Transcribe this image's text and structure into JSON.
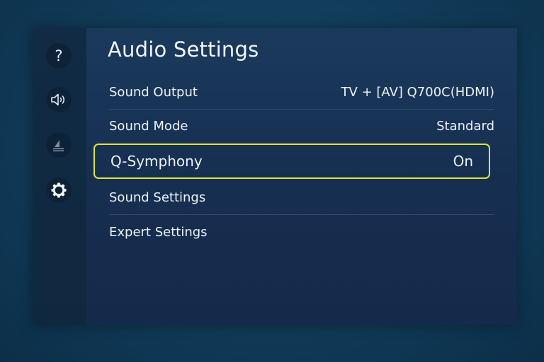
{
  "sidebar": {
    "items": [
      {
        "id": "support",
        "icon": "help-icon",
        "glyph": "?"
      },
      {
        "id": "sound",
        "icon": "speaker-icon"
      },
      {
        "id": "broadcasting",
        "icon": "broadcast-icon"
      },
      {
        "id": "general",
        "icon": "gear-icon"
      }
    ]
  },
  "page": {
    "title": "Audio Settings"
  },
  "menu": {
    "items": [
      {
        "label": "Sound Output",
        "value": "TV + [AV]  Q700C(HDMI)"
      },
      {
        "label": "Sound Mode",
        "value": "Standard"
      },
      {
        "label": "Q-Symphony",
        "value": "On",
        "selected": true
      },
      {
        "label": "Sound Settings",
        "value": ""
      },
      {
        "label": "Expert Settings",
        "value": ""
      }
    ]
  },
  "colors": {
    "focus_outline": "#e2e33a",
    "panel_bg": "#162e50",
    "sidebar_bg": "#112b45",
    "background": "#123e5c"
  }
}
